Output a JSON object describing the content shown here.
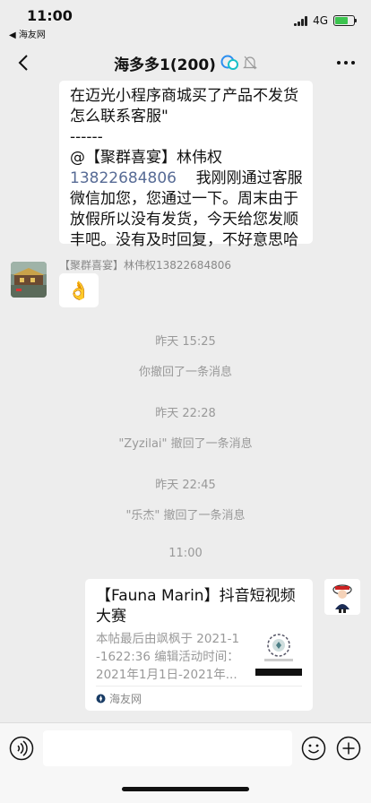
{
  "status_bar": {
    "time": "11:00",
    "back_app": "◀ 海友网",
    "network": "4G"
  },
  "nav": {
    "title": "海多多1(200)"
  },
  "messages": {
    "msg1_lines": [
      "在迈光小程序商城买了产品不发货",
      "怎么联系客服\"",
      "------",
      "@【聚群喜宴】林伟权",
      "我刚刚通过客服",
      "微信加您，您通过一下。周末由于",
      "放假所以没有发货，今天给您发顺",
      "丰吧。没有及时回复，不好意思哈"
    ],
    "phone": "13822684806",
    "sender_name": "【聚群喜宴】林伟权13822684806",
    "emoji": "👌"
  },
  "system": {
    "t1": "昨天 15:25",
    "r1": "你撤回了一条消息",
    "t2": "昨天 22:28",
    "r2": "\"Zyzilai\" 撤回了一条消息",
    "t3": "昨天 22:45",
    "r3": "\"乐杰\" 撤回了一条消息",
    "t4": "11:00"
  },
  "card": {
    "title": "【Fauna Marin】抖音短视频大赛",
    "body_lines": [
      "本帖最后由飒枫于 2021-1",
      "-1622:36 编辑活动时间：",
      "2021年1月1日-2021年..."
    ],
    "source": "海友网"
  },
  "icons": {
    "back": "chevron-left-icon",
    "more": "more-icon",
    "muted": "bell-off-icon",
    "voice": "voice-icon",
    "emoji": "emoji-icon",
    "plus": "plus-icon"
  }
}
